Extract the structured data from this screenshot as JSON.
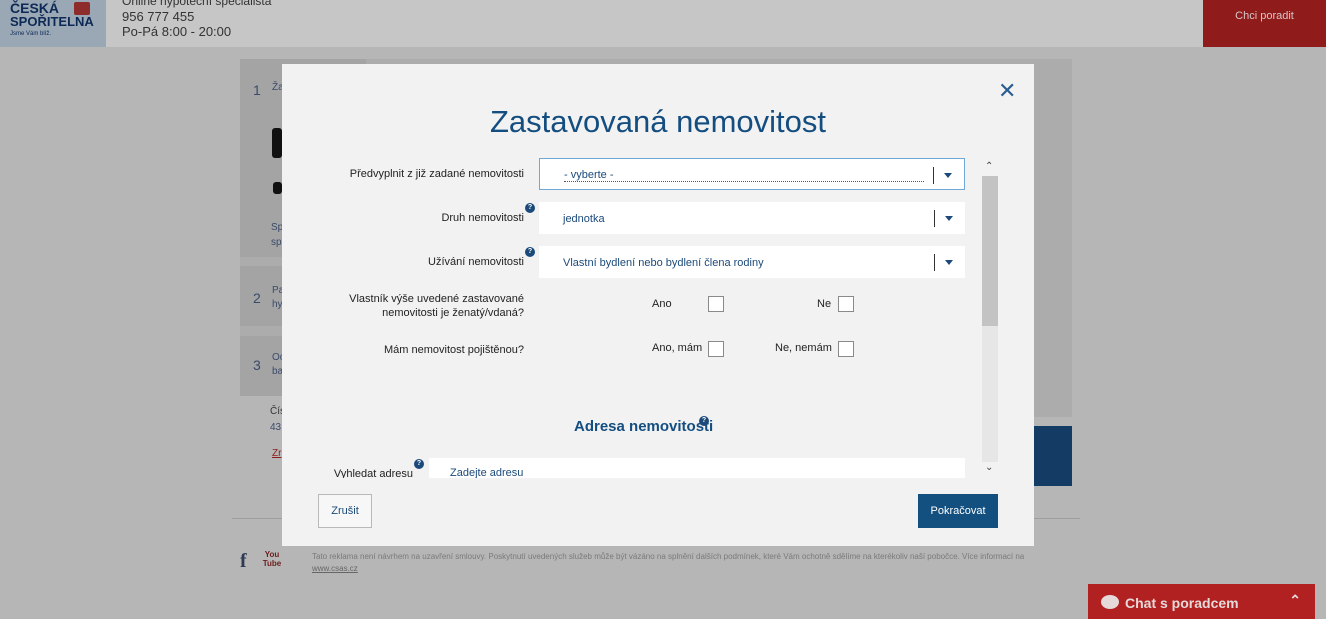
{
  "header": {
    "logo_line1": "ČESKÁ",
    "logo_line2": "SPOŘITELNA",
    "logo_tagline": "Jsme Vám blíž.",
    "specialist_title": "Online hypoteční specialista",
    "phone": "956 777 455",
    "hours": "Po-Pá 8:00 - 20:00",
    "advice_button": "Chci poradit"
  },
  "background_steps": [
    {
      "number": "1",
      "text": "Ža"
    },
    {
      "number": "2",
      "text": "Pa hy"
    },
    {
      "number": "3",
      "text": "Oc ba"
    }
  ],
  "background_text": {
    "sp": "Sp",
    "sp2": "sp",
    "cis": "Čís",
    "num": "43",
    "link": "Zr"
  },
  "footer": {
    "facebook_icon": "f",
    "youtube_icon": "You Tube",
    "disclaimer": "Tato reklama není návrhem na uzavření smlouvy. Poskytnutí uvedených služeb může být vázáno na splnění dalších podmínek, které Vám ochotně sdělíme na kterékoliv naší pobočce. Více informací na ",
    "disclaimer_link": "www.csas.cz"
  },
  "chat": {
    "label": "Chat s poradcem",
    "icon": "chat-bubble-icon",
    "toggle_icon": "chevron-up-icon"
  },
  "modal": {
    "title": "Zastavovaná nemovitost",
    "close_icon": "close-icon",
    "fields": {
      "prefill": {
        "label": "Předvyplnit z již zadané nemovitosti",
        "value": "- vyberte -"
      },
      "type": {
        "label": "Druh nemovitosti",
        "value": "jednotka",
        "help": "?"
      },
      "usage": {
        "label": "Užívání nemovitosti",
        "value": "Vlastní bydlení nebo bydlení člena rodiny",
        "help": "?"
      },
      "married": {
        "label_line1": "Vlastník výše uvedené zastavované",
        "label_line2": "nemovitosti je ženatý/vdaná?",
        "yes": "Ano",
        "no": "Ne"
      },
      "insured": {
        "label": "Mám nemovitost pojištěnou?",
        "yes": "Ano, mám",
        "no": "Ne, nemám"
      }
    },
    "address_section": {
      "title": "Adresa nemovitosti",
      "help": "?",
      "search_label": "Vyhledat adresu",
      "search_help": "?",
      "search_placeholder": "Zadejte adresu"
    },
    "buttons": {
      "cancel": "Zrušit",
      "continue": "Pokračovat"
    }
  }
}
